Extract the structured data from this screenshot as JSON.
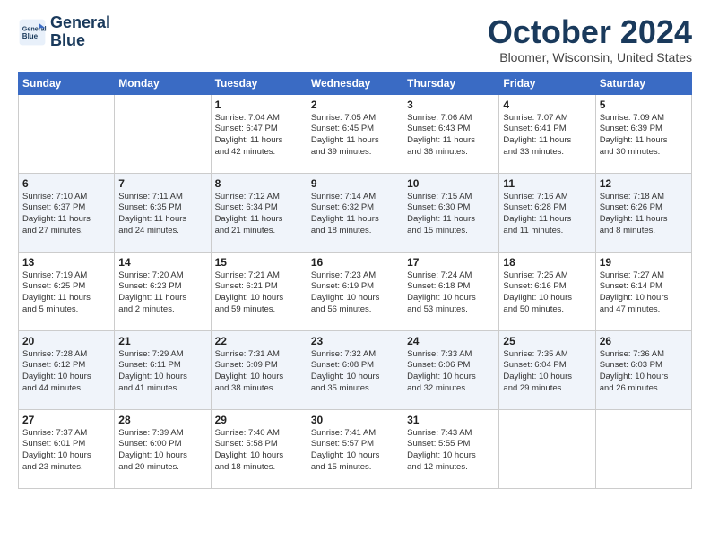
{
  "header": {
    "logo_line1": "General",
    "logo_line2": "Blue",
    "title": "October 2024",
    "subtitle": "Bloomer, Wisconsin, United States"
  },
  "days_of_week": [
    "Sunday",
    "Monday",
    "Tuesday",
    "Wednesday",
    "Thursday",
    "Friday",
    "Saturday"
  ],
  "weeks": [
    [
      {
        "day": "",
        "detail": ""
      },
      {
        "day": "",
        "detail": ""
      },
      {
        "day": "1",
        "detail": "Sunrise: 7:04 AM\nSunset: 6:47 PM\nDaylight: 11 hours\nand 42 minutes."
      },
      {
        "day": "2",
        "detail": "Sunrise: 7:05 AM\nSunset: 6:45 PM\nDaylight: 11 hours\nand 39 minutes."
      },
      {
        "day": "3",
        "detail": "Sunrise: 7:06 AM\nSunset: 6:43 PM\nDaylight: 11 hours\nand 36 minutes."
      },
      {
        "day": "4",
        "detail": "Sunrise: 7:07 AM\nSunset: 6:41 PM\nDaylight: 11 hours\nand 33 minutes."
      },
      {
        "day": "5",
        "detail": "Sunrise: 7:09 AM\nSunset: 6:39 PM\nDaylight: 11 hours\nand 30 minutes."
      }
    ],
    [
      {
        "day": "6",
        "detail": "Sunrise: 7:10 AM\nSunset: 6:37 PM\nDaylight: 11 hours\nand 27 minutes."
      },
      {
        "day": "7",
        "detail": "Sunrise: 7:11 AM\nSunset: 6:35 PM\nDaylight: 11 hours\nand 24 minutes."
      },
      {
        "day": "8",
        "detail": "Sunrise: 7:12 AM\nSunset: 6:34 PM\nDaylight: 11 hours\nand 21 minutes."
      },
      {
        "day": "9",
        "detail": "Sunrise: 7:14 AM\nSunset: 6:32 PM\nDaylight: 11 hours\nand 18 minutes."
      },
      {
        "day": "10",
        "detail": "Sunrise: 7:15 AM\nSunset: 6:30 PM\nDaylight: 11 hours\nand 15 minutes."
      },
      {
        "day": "11",
        "detail": "Sunrise: 7:16 AM\nSunset: 6:28 PM\nDaylight: 11 hours\nand 11 minutes."
      },
      {
        "day": "12",
        "detail": "Sunrise: 7:18 AM\nSunset: 6:26 PM\nDaylight: 11 hours\nand 8 minutes."
      }
    ],
    [
      {
        "day": "13",
        "detail": "Sunrise: 7:19 AM\nSunset: 6:25 PM\nDaylight: 11 hours\nand 5 minutes."
      },
      {
        "day": "14",
        "detail": "Sunrise: 7:20 AM\nSunset: 6:23 PM\nDaylight: 11 hours\nand 2 minutes."
      },
      {
        "day": "15",
        "detail": "Sunrise: 7:21 AM\nSunset: 6:21 PM\nDaylight: 10 hours\nand 59 minutes."
      },
      {
        "day": "16",
        "detail": "Sunrise: 7:23 AM\nSunset: 6:19 PM\nDaylight: 10 hours\nand 56 minutes."
      },
      {
        "day": "17",
        "detail": "Sunrise: 7:24 AM\nSunset: 6:18 PM\nDaylight: 10 hours\nand 53 minutes."
      },
      {
        "day": "18",
        "detail": "Sunrise: 7:25 AM\nSunset: 6:16 PM\nDaylight: 10 hours\nand 50 minutes."
      },
      {
        "day": "19",
        "detail": "Sunrise: 7:27 AM\nSunset: 6:14 PM\nDaylight: 10 hours\nand 47 minutes."
      }
    ],
    [
      {
        "day": "20",
        "detail": "Sunrise: 7:28 AM\nSunset: 6:12 PM\nDaylight: 10 hours\nand 44 minutes."
      },
      {
        "day": "21",
        "detail": "Sunrise: 7:29 AM\nSunset: 6:11 PM\nDaylight: 10 hours\nand 41 minutes."
      },
      {
        "day": "22",
        "detail": "Sunrise: 7:31 AM\nSunset: 6:09 PM\nDaylight: 10 hours\nand 38 minutes."
      },
      {
        "day": "23",
        "detail": "Sunrise: 7:32 AM\nSunset: 6:08 PM\nDaylight: 10 hours\nand 35 minutes."
      },
      {
        "day": "24",
        "detail": "Sunrise: 7:33 AM\nSunset: 6:06 PM\nDaylight: 10 hours\nand 32 minutes."
      },
      {
        "day": "25",
        "detail": "Sunrise: 7:35 AM\nSunset: 6:04 PM\nDaylight: 10 hours\nand 29 minutes."
      },
      {
        "day": "26",
        "detail": "Sunrise: 7:36 AM\nSunset: 6:03 PM\nDaylight: 10 hours\nand 26 minutes."
      }
    ],
    [
      {
        "day": "27",
        "detail": "Sunrise: 7:37 AM\nSunset: 6:01 PM\nDaylight: 10 hours\nand 23 minutes."
      },
      {
        "day": "28",
        "detail": "Sunrise: 7:39 AM\nSunset: 6:00 PM\nDaylight: 10 hours\nand 20 minutes."
      },
      {
        "day": "29",
        "detail": "Sunrise: 7:40 AM\nSunset: 5:58 PM\nDaylight: 10 hours\nand 18 minutes."
      },
      {
        "day": "30",
        "detail": "Sunrise: 7:41 AM\nSunset: 5:57 PM\nDaylight: 10 hours\nand 15 minutes."
      },
      {
        "day": "31",
        "detail": "Sunrise: 7:43 AM\nSunset: 5:55 PM\nDaylight: 10 hours\nand 12 minutes."
      },
      {
        "day": "",
        "detail": ""
      },
      {
        "day": "",
        "detail": ""
      }
    ]
  ]
}
